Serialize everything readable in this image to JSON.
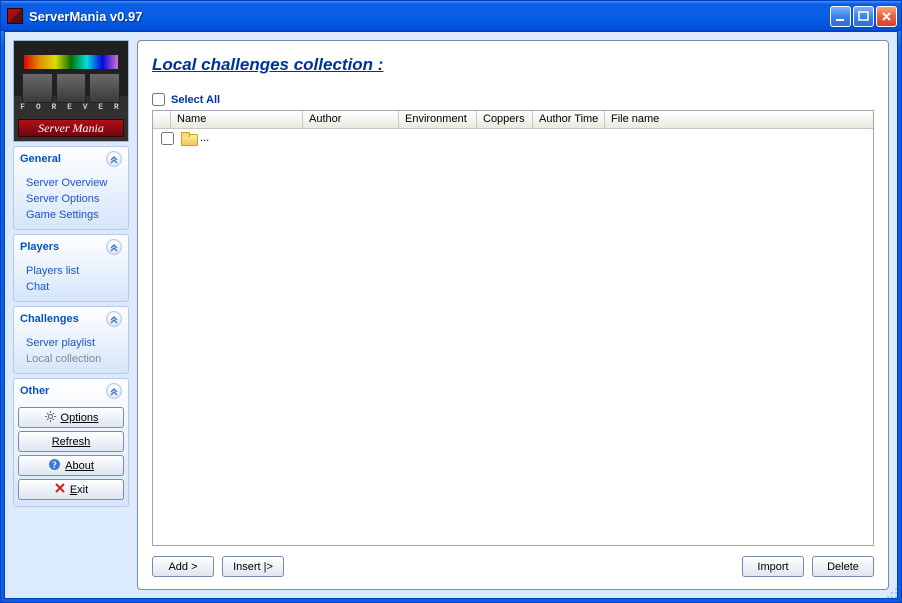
{
  "window": {
    "title": "ServerMania v0.97"
  },
  "logo": {
    "forever_text": "F O R E V E R",
    "brand_text": "Server Mania"
  },
  "sidebar": {
    "sections": {
      "general": {
        "title": "General",
        "items": [
          "Server Overview",
          "Server Options",
          "Game Settings"
        ]
      },
      "players": {
        "title": "Players",
        "items": [
          "Players list",
          "Chat"
        ]
      },
      "challenges": {
        "title": "Challenges",
        "items": [
          "Server playlist",
          "Local collection"
        ],
        "active_index": 1
      },
      "other": {
        "title": "Other",
        "buttons": {
          "options": "Options",
          "refresh": "Refresh",
          "about": "About",
          "exit": "Exit"
        }
      }
    }
  },
  "main": {
    "title": "Local challenges collection :",
    "select_all_label": "Select All",
    "columns": {
      "name": "Name",
      "author": "Author",
      "environment": "Environment",
      "coppers": "Coppers",
      "author_time": "Author Time",
      "file_name": "File name"
    },
    "rows": [
      {
        "name": "..."
      }
    ],
    "buttons": {
      "add": "Add >",
      "insert": "Insert |>",
      "import": "Import",
      "delete": "Delete"
    }
  }
}
